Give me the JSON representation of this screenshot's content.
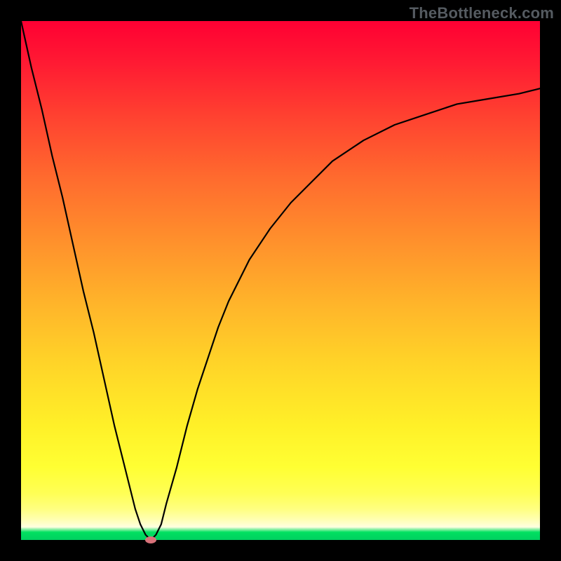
{
  "watermark": "TheBottleneck.com",
  "colors": {
    "frame": "#000000",
    "curve": "#000000",
    "marker": "#d9727a",
    "gradient_top": "#ff0033",
    "gradient_bottom": "#00d060"
  },
  "chart_data": {
    "type": "line",
    "title": "",
    "xlabel": "",
    "ylabel": "",
    "xlim": [
      0,
      100
    ],
    "ylim": [
      0,
      100
    ],
    "legend": false,
    "grid": false,
    "series": [
      {
        "name": "bottleneck-curve",
        "x": [
          0,
          2,
          4,
          6,
          8,
          10,
          12,
          14,
          16,
          18,
          20,
          21,
          22,
          23,
          24,
          25,
          26,
          27,
          28,
          30,
          32,
          34,
          36,
          38,
          40,
          44,
          48,
          52,
          56,
          60,
          66,
          72,
          78,
          84,
          90,
          96,
          100
        ],
        "values": [
          100,
          91,
          83,
          74,
          66,
          57,
          48,
          40,
          31,
          22,
          14,
          10,
          6,
          3,
          1,
          0,
          1,
          3,
          7,
          14,
          22,
          29,
          35,
          41,
          46,
          54,
          60,
          65,
          69,
          73,
          77,
          80,
          82,
          84,
          85,
          86,
          87
        ]
      }
    ],
    "annotations": [
      {
        "name": "minimum-marker",
        "x": 25,
        "y": 0
      }
    ]
  }
}
